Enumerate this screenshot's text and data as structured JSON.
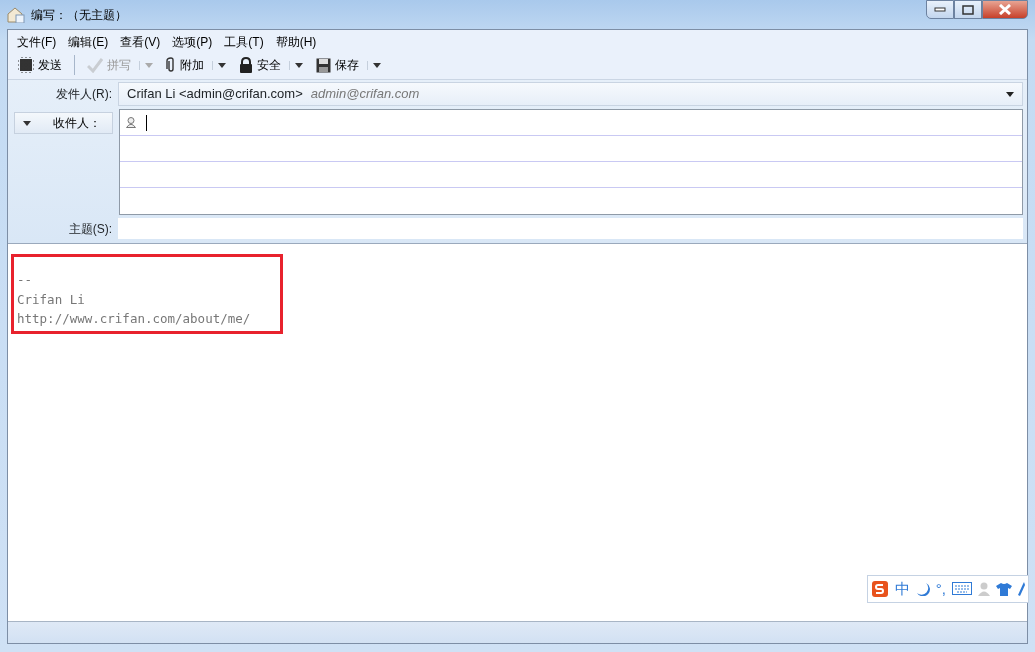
{
  "window": {
    "title": "编写：（无主题）"
  },
  "menu": [
    "文件(F)",
    "编辑(E)",
    "查看(V)",
    "选项(P)",
    "工具(T)",
    "帮助(H)"
  ],
  "toolbar": [
    {
      "kind": "send",
      "label": "发送",
      "disabled": false,
      "dropdown": false
    },
    {
      "kind": "spell",
      "label": "拼写",
      "disabled": true,
      "dropdown": true
    },
    {
      "kind": "attach",
      "label": "附加",
      "disabled": false,
      "dropdown": true
    },
    {
      "kind": "security",
      "label": "安全",
      "disabled": false,
      "dropdown": true
    },
    {
      "kind": "save",
      "label": "保存",
      "disabled": false,
      "dropdown": true
    }
  ],
  "header": {
    "from_label": "发件人(R):",
    "from_value": "Crifan Li <admin@crifan.com>",
    "from_hint": "admin@crifan.com",
    "to_label": "收件人：",
    "subject_label": "主题(S):"
  },
  "body": {
    "lines": [
      "--",
      "Crifan Li",
      "http://www.crifan.com/about/me/"
    ],
    "highlighted": true
  },
  "ime_bar": {
    "mode": "中",
    "punct": "°,"
  }
}
